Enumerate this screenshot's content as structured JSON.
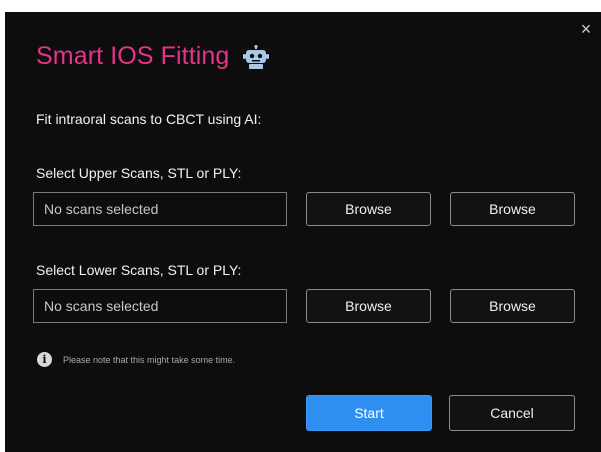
{
  "dialog": {
    "title": "Smart IOS Fitting",
    "title_color": "#e6338a",
    "title_icon": "robot-icon",
    "close_icon": "close-icon",
    "close_glyph": "×",
    "subtitle": "Fit intraoral scans to CBCT using AI:"
  },
  "upper": {
    "label": "Select Upper Scans, STL or PLY:",
    "input_value": "No scans selected",
    "browse1_label": "Browse",
    "browse2_label": "Browse"
  },
  "lower": {
    "label": "Select Lower Scans, STL or PLY:",
    "input_value": "No scans selected",
    "browse1_label": "Browse",
    "browse2_label": "Browse"
  },
  "note": {
    "icon": "info-icon",
    "icon_glyph": "i",
    "text": "Please note that this might take some time."
  },
  "actions": {
    "start_label": "Start",
    "cancel_label": "Cancel",
    "start_color": "#2f8ff0"
  }
}
